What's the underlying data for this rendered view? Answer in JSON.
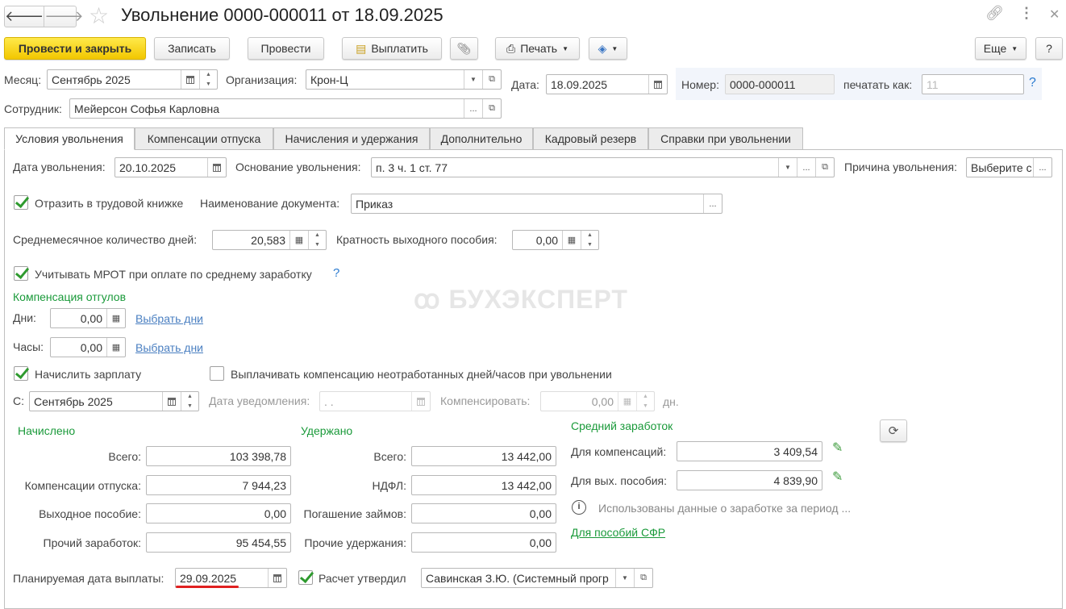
{
  "window": {
    "title": "Увольнение 0000-000011 от 18.09.2025"
  },
  "toolbar": {
    "post_close": "Провести и закрыть",
    "save": "Записать",
    "post": "Провести",
    "pay": "Выплатить",
    "print": "Печать",
    "more": "Еще",
    "help": "?"
  },
  "header": {
    "month_label": "Месяц:",
    "month_value": "Сентябрь 2025",
    "org_label": "Организация:",
    "org_value": "Крон-Ц",
    "date_label": "Дата:",
    "date_value": "18.09.2025",
    "number_label": "Номер:",
    "number_value": "0000-000011",
    "print_as_label": "печатать как:",
    "print_as_value": "11",
    "employee_label": "Сотрудник:",
    "employee_value": "Мейерсон Софья Карловна"
  },
  "tabs": [
    {
      "label": "Условия увольнения",
      "active": true
    },
    {
      "label": "Компенсации отпуска"
    },
    {
      "label": "Начисления и удержания"
    },
    {
      "label": "Дополнительно"
    },
    {
      "label": "Кадровый резерв"
    },
    {
      "label": "Справки при увольнении"
    }
  ],
  "main": {
    "dismissal_date_label": "Дата увольнения:",
    "dismissal_date": "20.10.2025",
    "basis_label": "Основание увольнения:",
    "basis_value": "п. 3 ч. 1 ст. 77",
    "reason_label": "Причина увольнения:",
    "reason_value": "Выберите с",
    "workbook_check": "Отразить в трудовой книжке",
    "doc_name_label": "Наименование документа:",
    "doc_name_value": "Приказ",
    "avg_days_label": "Среднемесячное количество дней:",
    "avg_days_value": "20,583",
    "severance_mult_label": "Кратность выходного пособия:",
    "severance_mult_value": "0,00",
    "mrot_check": "Учитывать МРОТ при оплате по среднему заработку",
    "comp_group": "Компенсация отгулов",
    "days_label": "Дни:",
    "days_value": "0,00",
    "hours_label": "Часы:",
    "hours_value": "0,00",
    "choose_days": "Выбрать дни",
    "accrue_salary": "Начислить зарплату",
    "pay_comp_check": "Выплачивать компенсацию неотработанных дней/часов при увольнении",
    "from_label": "С:",
    "from_value": "Сентябрь 2025",
    "notice_date_label": "Дата уведомления:",
    "notice_date_value": " .  .",
    "compensate_label": "Компенсировать:",
    "compensate_value": "0,00",
    "days_unit": "дн."
  },
  "accrued": {
    "title": "Начислено",
    "rows": [
      {
        "label": "Всего:",
        "value": "103 398,78"
      },
      {
        "label": "Компенсации отпуска:",
        "value": "7 944,23"
      },
      {
        "label": "Выходное пособие:",
        "value": "0,00"
      },
      {
        "label": "Прочий заработок:",
        "value": "95 454,55"
      }
    ]
  },
  "withheld": {
    "title": "Удержано",
    "rows": [
      {
        "label": "Всего:",
        "value": "13 442,00"
      },
      {
        "label": "НДФЛ:",
        "value": "13 442,00"
      },
      {
        "label": "Погашение займов:",
        "value": "0,00"
      },
      {
        "label": "Прочие удержания:",
        "value": "0,00"
      }
    ]
  },
  "average": {
    "title": "Средний заработок",
    "comp_label": "Для компенсаций:",
    "comp_value": "3 409,54",
    "sev_label": "Для вых. пособия:",
    "sev_value": "4 839,90",
    "info": "Использованы данные о заработке за период ...",
    "sfr_link": "Для пособий СФР"
  },
  "footer": {
    "pay_date_label": "Планируемая дата выплаты:",
    "pay_date_value": "29.09.2025",
    "approved_check": "Расчет утвердил",
    "approved_value": "Савинская З.Ю. (Системный прогр"
  },
  "watermark": "БУХЭКСПЕРТ",
  "colors": {
    "accent_yellow": "#f5cc00",
    "group_green": "#1a9a3a",
    "link_blue": "#4a7fc1",
    "underline_red": "#e02020"
  }
}
